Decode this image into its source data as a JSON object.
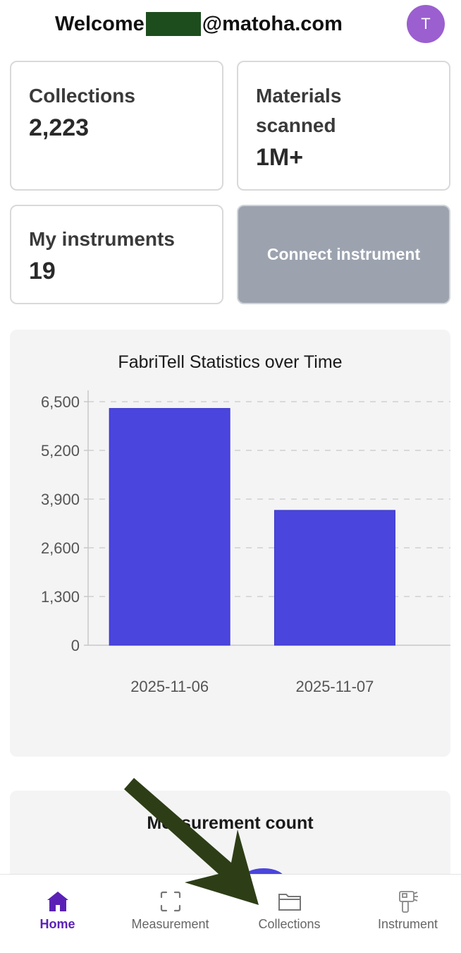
{
  "header": {
    "welcome_prefix": "Welcome",
    "email_domain": "@matoha.com",
    "avatar_initial": "T"
  },
  "cards": {
    "collections": {
      "title": "Collections",
      "value": "2,223"
    },
    "materials": {
      "title_line1": "Materials",
      "title_line2": "scanned",
      "value": "1M+"
    },
    "instruments": {
      "title": "My instruments",
      "value": "19"
    },
    "connect_label": "Connect instrument"
  },
  "chart_panel": {
    "title": "FabriTell Statistics over Time"
  },
  "chart_data": {
    "type": "bar",
    "title": "FabriTell Statistics over Time",
    "categories": [
      "2025-11-06",
      "2025-11-07"
    ],
    "values": [
      6320,
      3600
    ],
    "yticks": [
      "0",
      "1,300",
      "2,600",
      "3,900",
      "5,200",
      "6,500"
    ],
    "ytick_values": [
      0,
      1300,
      2600,
      3900,
      5200,
      6500
    ],
    "ylim": [
      0,
      6500
    ],
    "bar_color": "#4a45dd",
    "grid": "horizontal-dashed"
  },
  "panel2": {
    "title": "Measurement count"
  },
  "nav": {
    "home": "Home",
    "measurement": "Measurement",
    "collections": "Collections",
    "instrument": "Instrument"
  },
  "colors": {
    "accent": "#5b21b6",
    "avatar": "#9b5fd0",
    "connect_bg": "#9ca3af",
    "arrow": "#2d3e17"
  },
  "icons": {
    "home": "home-icon",
    "measurement": "scan-frame-icon",
    "collections": "folder-icon",
    "instrument": "scanner-gun-icon"
  }
}
